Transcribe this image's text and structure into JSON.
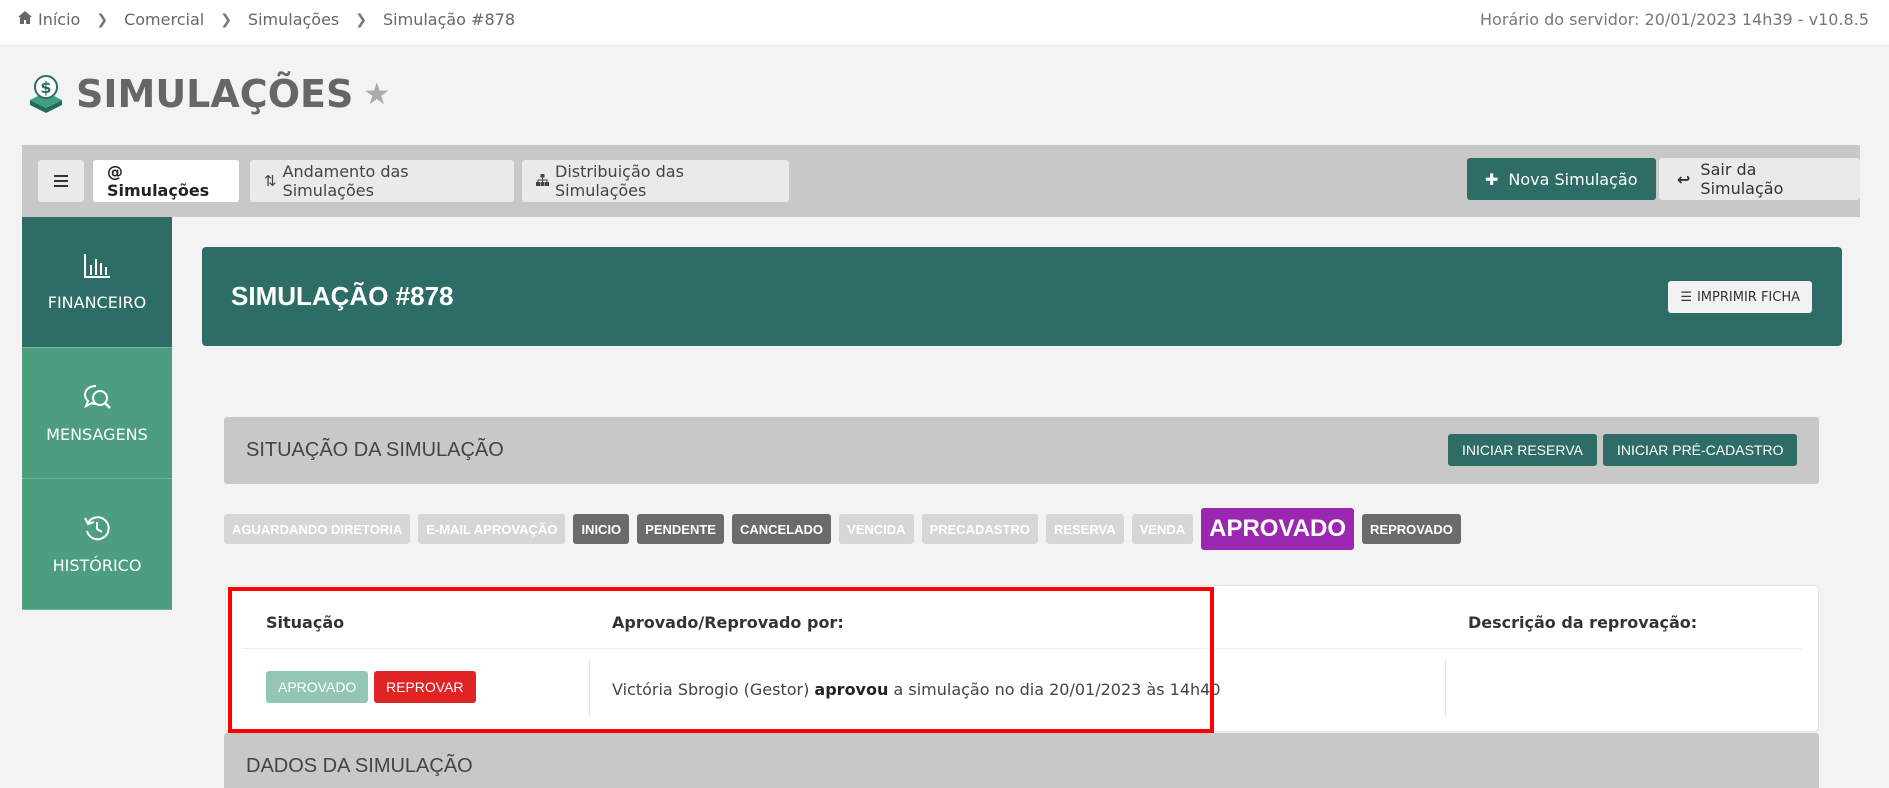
{
  "breadcrumb": {
    "items": [
      "Início",
      "Comercial",
      "Simulações",
      "Simulação #878"
    ]
  },
  "server_info": "Horário do servidor: 20/01/2023 14h39 - v10.8.5",
  "page": {
    "title": "SIMULAÇÕES"
  },
  "tabs": [
    {
      "label": "@ Simulações",
      "active": true
    },
    {
      "label": "Andamento das Simulações",
      "active": false
    },
    {
      "label": "Distribuição das Simulações",
      "active": false
    }
  ],
  "actions": {
    "new_label": "Nova Simulação",
    "exit_label": "Sair da Simulação"
  },
  "sidebar": {
    "items": [
      {
        "label": "FINANCEIRO",
        "icon": "bar-chart-icon"
      },
      {
        "label": "MENSAGENS",
        "icon": "chat-search-icon"
      },
      {
        "label": "HISTÓRICO",
        "icon": "history-icon"
      }
    ]
  },
  "header": {
    "title": "SIMULAÇÃO #878",
    "print_label": "IMPRIMIR FICHA"
  },
  "status_section": {
    "title": "SITUAÇÃO DA SIMULAÇÃO",
    "start_reserve": "INICIAR RESERVA",
    "start_precad": "INICIAR PRÉ-CADASTRO"
  },
  "status_badges": [
    {
      "label": "AGUARDANDO DIRETORIA",
      "state": "faded"
    },
    {
      "label": "E-MAIL APROVAÇÃO",
      "state": "faded"
    },
    {
      "label": "INICIO",
      "state": "gray"
    },
    {
      "label": "PENDENTE",
      "state": "gray"
    },
    {
      "label": "CANCELADO",
      "state": "gray"
    },
    {
      "label": "VENCIDA",
      "state": "faded"
    },
    {
      "label": "PRECADASTRO",
      "state": "faded"
    },
    {
      "label": "RESERVA",
      "state": "faded"
    },
    {
      "label": "VENDA",
      "state": "faded"
    },
    {
      "label": "APROVADO",
      "state": "current"
    },
    {
      "label": "REPROVADO",
      "state": "gray"
    }
  ],
  "approval": {
    "col_situacao": "Situação",
    "col_por": "Aprovado/Reprovado por:",
    "col_desc": "Descrição da reprovação:",
    "approve_label": "APROVADO",
    "reject_label": "REPROVAR",
    "approver": "Victória Sbrogio (Gestor)",
    "action": "aprovou",
    "detail": "a simulação no dia 20/01/2023 às 14h40"
  },
  "data_section": {
    "title": "DADOS DA SIMULAÇÃO"
  },
  "colors": {
    "primary": "#2e6d66",
    "sidebar_light": "#4d9e7e",
    "current_status": "#9b27b0",
    "reject": "#e02424",
    "highlight": "#ff0000"
  }
}
